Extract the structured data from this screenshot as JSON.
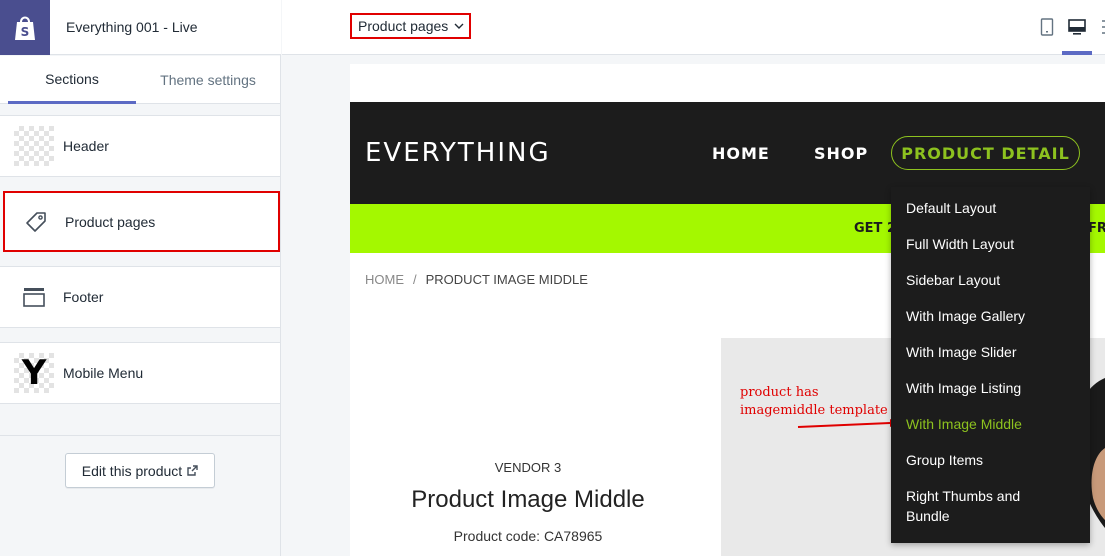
{
  "app": {
    "store_title": "Everything 001 - Live",
    "logo_icon": "shopify-bag-icon"
  },
  "sidebar": {
    "tabs": [
      {
        "label": "Sections",
        "active": true
      },
      {
        "label": "Theme settings",
        "active": false
      }
    ],
    "sections": [
      {
        "label": "Header",
        "icon": "checker-thumbnail-icon"
      },
      {
        "label": "Product pages",
        "icon": "tag-icon",
        "highlighted": true
      },
      {
        "label": "Footer",
        "icon": "footer-layout-icon"
      },
      {
        "label": "Mobile Menu",
        "icon": "mobile-menu-thumbnail-icon"
      }
    ],
    "edit_button": "Edit this product"
  },
  "toolbar": {
    "template_select": "Product pages",
    "devices": [
      "mobile-icon",
      "desktop-icon",
      "fullscreen-icon"
    ],
    "active_device": "desktop-icon"
  },
  "preview": {
    "site_logo": "EVERYTHING",
    "nav": {
      "home": "HOME",
      "shop": "SHOP",
      "detail": "PRODUCT DETAIL"
    },
    "promo_text": "GET 2",
    "promo_text_right": "FR",
    "breadcrumb": {
      "home": "HOME",
      "separator": "/",
      "current": "PRODUCT IMAGE MIDDLE"
    },
    "vendor": "VENDOR 3",
    "product_title": "Product Image Middle",
    "product_code": "Product code: CA78965",
    "annotation_line1": "product has",
    "annotation_line2": "imagemiddle template",
    "dropdown": [
      {
        "label": "Default Layout",
        "active": false
      },
      {
        "label": "Full Width Layout",
        "active": false
      },
      {
        "label": "Sidebar Layout",
        "active": false
      },
      {
        "label": "With Image Gallery",
        "active": false
      },
      {
        "label": "With Image Slider",
        "active": false
      },
      {
        "label": "With Image Listing",
        "active": false
      },
      {
        "label": "With Image Middle",
        "active": true
      },
      {
        "label": "Group Items",
        "active": false
      },
      {
        "label": "Right Thumbs and",
        "active": false
      },
      {
        "label": "Bundle",
        "active": false
      }
    ]
  },
  "colors": {
    "accent": "#5c6ac4",
    "highlight_box": "#e00000",
    "nav_active": "#8dc21f",
    "promo_bar": "#a4f800",
    "dark": "#1c1c1c"
  }
}
